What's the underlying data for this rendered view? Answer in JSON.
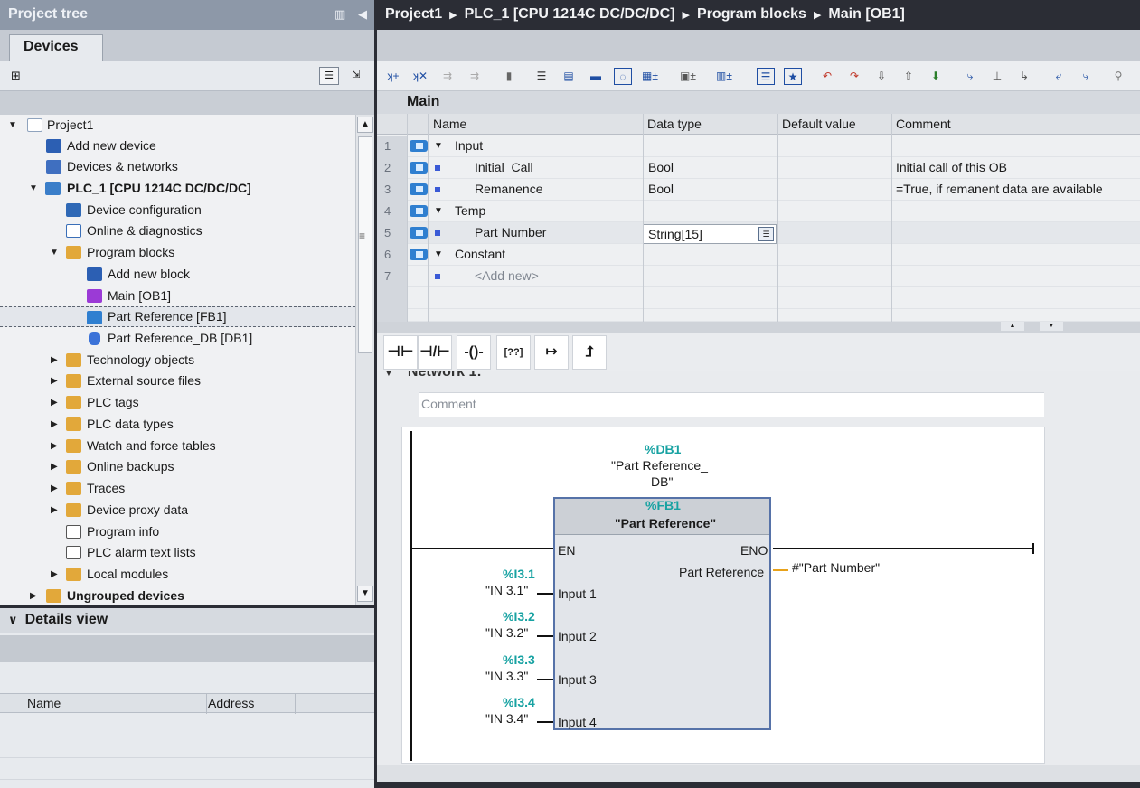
{
  "project_tree": {
    "title": "Project tree",
    "tab": "Devices",
    "items": [
      {
        "label": "Project1"
      },
      {
        "label": "Add new device"
      },
      {
        "label": "Devices & networks"
      },
      {
        "label": "PLC_1 [CPU 1214C DC/DC/DC]"
      },
      {
        "label": "Device configuration"
      },
      {
        "label": "Online & diagnostics"
      },
      {
        "label": "Program blocks"
      },
      {
        "label": "Add new block"
      },
      {
        "label": "Main [OB1]"
      },
      {
        "label": "Part Reference [FB1]"
      },
      {
        "label": "Part Reference_DB [DB1]"
      },
      {
        "label": "Technology objects"
      },
      {
        "label": "External source files"
      },
      {
        "label": "PLC tags"
      },
      {
        "label": "PLC data types"
      },
      {
        "label": "Watch and force tables"
      },
      {
        "label": "Online backups"
      },
      {
        "label": "Traces"
      },
      {
        "label": "Device proxy data"
      },
      {
        "label": "Program info"
      },
      {
        "label": "PLC alarm text lists"
      },
      {
        "label": "Local modules"
      },
      {
        "label": "Ungrouped devices"
      }
    ]
  },
  "details_view": {
    "title": "Details view",
    "columns": [
      "Name",
      "Address"
    ]
  },
  "breadcrumb": [
    "Project1",
    "PLC_1 [CPU 1214C DC/DC/DC]",
    "Program blocks",
    "Main [OB1]"
  ],
  "block_name": "Main",
  "interface": {
    "columns": [
      "Name",
      "Data type",
      "Default value",
      "Comment"
    ],
    "rows": [
      {
        "num": "1",
        "name": "Input",
        "type": "",
        "comment": ""
      },
      {
        "num": "2",
        "name": "Initial_Call",
        "type": "Bool",
        "comment": "Initial call of this OB"
      },
      {
        "num": "3",
        "name": "Remanence",
        "type": "Bool",
        "comment": "=True, if remanent data are available"
      },
      {
        "num": "4",
        "name": "Temp",
        "type": "",
        "comment": ""
      },
      {
        "num": "5",
        "name": "Part Number",
        "type": "String[15]",
        "comment": ""
      },
      {
        "num": "6",
        "name": "Constant",
        "type": "",
        "comment": ""
      },
      {
        "num": "7",
        "name": "<Add new>",
        "type": "",
        "comment": ""
      }
    ]
  },
  "network": {
    "title": "Network 1:",
    "comment_placeholder": "Comment",
    "db_addr": "%DB1",
    "db_name_1": "\"Part Reference_",
    "db_name_2": "DB\"",
    "fb_addr": "%FB1",
    "fb_name": "\"Part Reference\"",
    "en": "EN",
    "eno": "ENO",
    "out_pin": "Part Reference",
    "out_var": "#\"Part Number\"",
    "inputs": [
      {
        "addr": "%I3.1",
        "tag": "\"IN 3.1\"",
        "pin": "Input 1"
      },
      {
        "addr": "%I3.2",
        "tag": "\"IN 3.2\"",
        "pin": "Input 2"
      },
      {
        "addr": "%I3.3",
        "tag": "\"IN 3.3\"",
        "pin": "Input 3"
      },
      {
        "addr": "%I3.4",
        "tag": "\"IN 3.4\"",
        "pin": "Input 4"
      }
    ]
  },
  "ladder_tools": [
    "⊣⊢",
    "⊣/⊢",
    "-()-",
    "[??]",
    "↦",
    "⮥"
  ],
  "colors": {
    "accent": "#17a2a2",
    "fb_border": "#5672a8",
    "title_bar": "#8d98a8",
    "dark": "#2b2d35"
  }
}
